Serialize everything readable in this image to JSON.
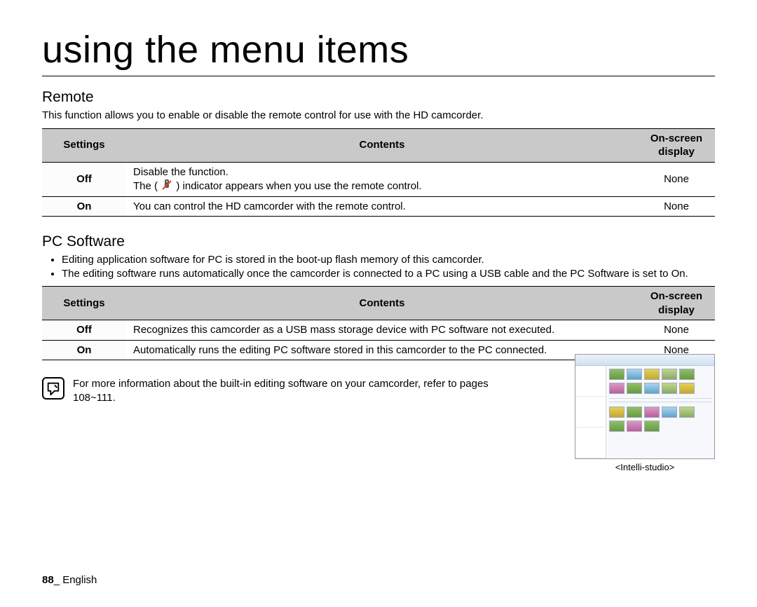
{
  "page": {
    "title": "using the menu items",
    "number": "88",
    "language_label": "English"
  },
  "remote": {
    "heading": "Remote",
    "description": "This function allows you to enable or disable the remote control for use with the HD camcorder.",
    "table": {
      "headers": {
        "settings": "Settings",
        "contents": "Contents",
        "display": "On-screen display"
      },
      "rows": [
        {
          "setting": "Off",
          "contents_line1": "Disable the function.",
          "contents_line2a": "The ( ",
          "contents_line2b": " ) indicator appears when you use the remote control.",
          "display": "None"
        },
        {
          "setting": "On",
          "contents": "You can control the HD camcorder with the remote control.",
          "display": "None"
        }
      ]
    },
    "indicator_icon_name": "remote-disabled-icon"
  },
  "pc_software": {
    "heading": "PC Software",
    "bullets": [
      "Editing application software for PC is stored in the boot-up flash memory of this camcorder.",
      "The editing software runs automatically once the camcorder is connected to a PC using a USB cable and the PC Software is set to On."
    ],
    "table": {
      "headers": {
        "settings": "Settings",
        "contents": "Contents",
        "display": "On-screen display"
      },
      "rows": [
        {
          "setting": "Off",
          "contents": "Recognizes this camcorder as a USB mass storage device with PC software not executed.",
          "display": "None"
        },
        {
          "setting": "On",
          "contents": "Automatically runs the editing PC software stored in this camcorder to the PC connected.",
          "display": "None"
        }
      ]
    },
    "note": "For more information about the built-in editing software on your camcorder, refer to pages 108~111.",
    "screenshot_caption": "<Intelli-studio>"
  }
}
